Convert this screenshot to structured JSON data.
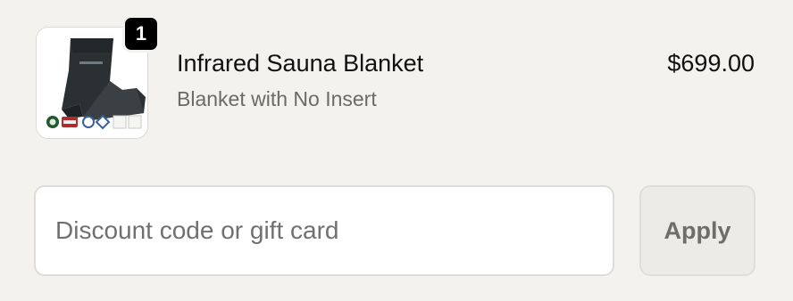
{
  "cart": {
    "item": {
      "quantity": "1",
      "title": "Infrared Sauna Blanket",
      "variant": "Blanket with No Insert",
      "price": "$699.00",
      "image_icon": "sauna-blanket-product-image"
    }
  },
  "discount": {
    "placeholder": "Discount code or gift card",
    "value": "",
    "apply_label": "Apply"
  },
  "colors": {
    "background": "#f3f2ef",
    "badge": "#000000",
    "apply_button": "#ecebe8",
    "text_secondary": "#6b6a67"
  }
}
